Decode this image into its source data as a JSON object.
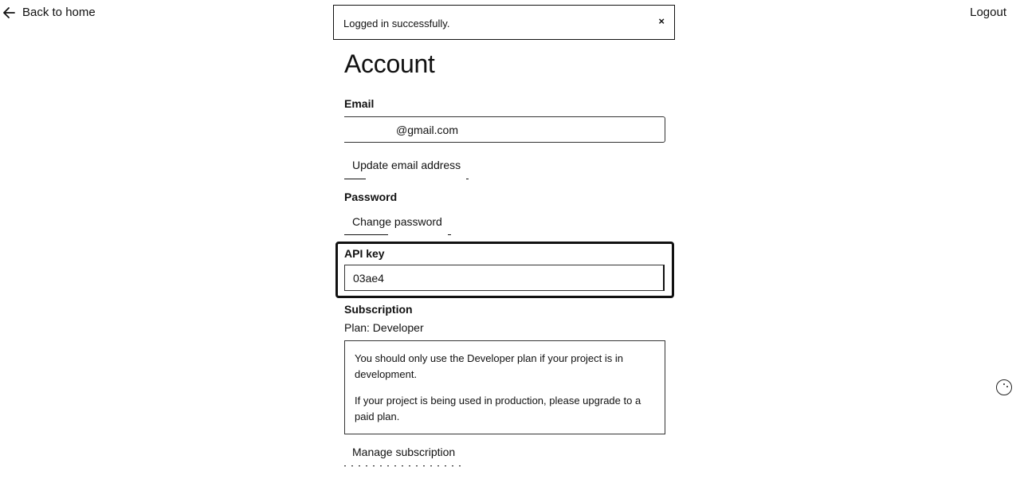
{
  "nav": {
    "back_label": "Back to home",
    "logout_label": "Logout"
  },
  "toast": {
    "message": "Logged in successfully.",
    "close_glyph": "×"
  },
  "page": {
    "title": "Account"
  },
  "email_section": {
    "label": "Email",
    "value": "@gmail.com",
    "update_button": "Update email address"
  },
  "password_section": {
    "label": "Password",
    "change_button": "Change password"
  },
  "api_section": {
    "label": "API key",
    "value": "03ae4"
  },
  "subscription_section": {
    "label": "Subscription",
    "plan_text": "Plan: Developer",
    "notice_line1": "You should only use the Developer plan if your project is in development.",
    "notice_line2": "If your project is being used in production, please upgrade to a paid plan.",
    "manage_button": "Manage subscription"
  },
  "icons": {
    "back": "arrow-left-icon",
    "spinner": "loading-spinner-icon"
  }
}
